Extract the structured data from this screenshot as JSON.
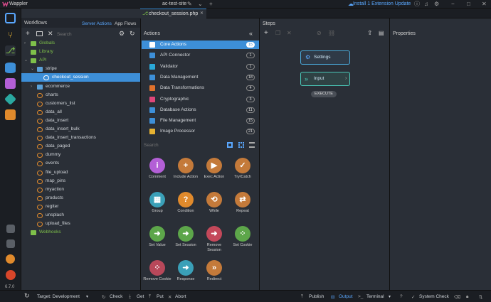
{
  "app": {
    "title": "Wappler",
    "site": "ac-test-site",
    "install_label": "Install 1 Extension Update",
    "version": "6.7.0"
  },
  "colors": {
    "accent": "#3d8fd8",
    "folder": "#5aa0d8",
    "file": "#e08a2c",
    "green": "#7ec04a"
  },
  "workflows": {
    "title": "Workflows",
    "tabs": [
      "Server Actions",
      "App Flows"
    ],
    "search_placeholder": "Search",
    "tree": [
      {
        "label": "Globals",
        "type": "green-folder",
        "level": 0,
        "caret": "right"
      },
      {
        "label": "Library",
        "type": "green-folder",
        "level": 0,
        "caret": ""
      },
      {
        "label": "API",
        "type": "green-folder",
        "level": 0,
        "caret": "down"
      },
      {
        "label": "stripe",
        "type": "folder",
        "level": 1,
        "caret": "down"
      },
      {
        "label": "checkout_session",
        "type": "file",
        "level": 2,
        "caret": "",
        "selected": true
      },
      {
        "label": "ecommerce",
        "type": "folder",
        "level": 1,
        "caret": "right"
      },
      {
        "label": "charts",
        "type": "file",
        "level": 1,
        "caret": ""
      },
      {
        "label": "customers_list",
        "type": "file",
        "level": 1,
        "caret": ""
      },
      {
        "label": "data_all",
        "type": "file",
        "level": 1,
        "caret": ""
      },
      {
        "label": "data_insert",
        "type": "file",
        "level": 1,
        "caret": ""
      },
      {
        "label": "data_insert_bulk",
        "type": "file",
        "level": 1,
        "caret": ""
      },
      {
        "label": "data_insert_transactions",
        "type": "file",
        "level": 1,
        "caret": ""
      },
      {
        "label": "data_paged",
        "type": "file",
        "level": 1,
        "caret": ""
      },
      {
        "label": "dummy",
        "type": "file",
        "level": 1,
        "caret": ""
      },
      {
        "label": "events",
        "type": "file",
        "level": 1,
        "caret": ""
      },
      {
        "label": "file_upload",
        "type": "file",
        "level": 1,
        "caret": ""
      },
      {
        "label": "map_pins",
        "type": "file",
        "level": 1,
        "caret": ""
      },
      {
        "label": "myaction",
        "type": "file",
        "level": 1,
        "caret": ""
      },
      {
        "label": "products",
        "type": "file",
        "level": 1,
        "caret": ""
      },
      {
        "label": "regiter",
        "type": "file",
        "level": 1,
        "caret": ""
      },
      {
        "label": "unsplash",
        "type": "file",
        "level": 1,
        "caret": ""
      },
      {
        "label": "upload_files",
        "type": "file",
        "level": 1,
        "caret": ""
      },
      {
        "label": "Webhooks",
        "type": "green-folder",
        "level": 0,
        "caret": ""
      }
    ]
  },
  "editor_tab": {
    "label": "checkout_session.php",
    "close": "✕"
  },
  "actions": {
    "title": "Actions",
    "search_placeholder": "Search",
    "categories": [
      {
        "label": "Core Actions",
        "count": "15",
        "color": "#3d8fd8",
        "icon": "box-icon",
        "selected": true
      },
      {
        "label": "API Connector",
        "count": "1",
        "color": "#3d8fd8",
        "icon": "api-icon"
      },
      {
        "label": "Validator",
        "count": "1",
        "color": "#2aa8d8",
        "icon": "check-icon"
      },
      {
        "label": "Data Management",
        "count": "18",
        "color": "#3d8fd8",
        "icon": "data-icon"
      },
      {
        "label": "Data Transformations",
        "count": "4",
        "color": "#e0722c",
        "icon": "transform-icon"
      },
      {
        "label": "Cryptographic",
        "count": "3",
        "color": "#e0467a",
        "icon": "key-icon"
      },
      {
        "label": "Database Actions",
        "count": "11",
        "color": "#3d8fd8",
        "icon": "database-icon"
      },
      {
        "label": "File Management",
        "count": "15",
        "color": "#3d8fd8",
        "icon": "file-icon"
      },
      {
        "label": "Image Processor",
        "count": "21",
        "color": "#e6b232",
        "icon": "image-icon"
      }
    ],
    "tools": [
      {
        "label": "Comment",
        "glyph": "i",
        "color": "#b35fd6",
        "icon": "comment-icon"
      },
      {
        "label": "Include Action",
        "glyph": "+",
        "color": "#c47a3a",
        "icon": "include-icon"
      },
      {
        "label": "Exec Action",
        "glyph": "▶",
        "color": "#c47a3a",
        "icon": "exec-icon"
      },
      {
        "label": "Try/Catch",
        "glyph": "✓",
        "color": "#c47a3a",
        "icon": "trycatch-icon"
      },
      {
        "label": "Group",
        "glyph": "▦",
        "color": "#3aa0b8",
        "icon": "group-icon"
      },
      {
        "label": "Condition",
        "glyph": "?",
        "color": "#e08a2c",
        "icon": "condition-icon"
      },
      {
        "label": "While",
        "glyph": "⟲",
        "color": "#c47a3a",
        "icon": "while-icon"
      },
      {
        "label": "Repeat",
        "glyph": "⇄",
        "color": "#c47a3a",
        "icon": "repeat-icon"
      },
      {
        "label": "Set Value",
        "glyph": "➜",
        "color": "#5da64a",
        "icon": "setvalue-icon"
      },
      {
        "label": "Set Session",
        "glyph": "➜",
        "color": "#5da64a",
        "icon": "setsession-icon"
      },
      {
        "label": "Remove Session",
        "glyph": "➜",
        "color": "#c4485a",
        "icon": "removesession-icon"
      },
      {
        "label": "Set Cookie",
        "glyph": "⁘",
        "color": "#5da64a",
        "icon": "setcookie-icon"
      },
      {
        "label": "Remove Cookie",
        "glyph": "⁘",
        "color": "#b8485a",
        "icon": "removecookie-icon"
      },
      {
        "label": "Response",
        "glyph": "➜",
        "color": "#3aa0b8",
        "icon": "response-icon"
      },
      {
        "label": "Redirect",
        "glyph": "»",
        "color": "#c47a3a",
        "icon": "redirect-icon"
      }
    ]
  },
  "steps": {
    "title": "Steps",
    "items": [
      {
        "label": "Settings"
      },
      {
        "label": "Input"
      }
    ],
    "execute_label": "EXECUTE"
  },
  "properties": {
    "title": "Properties"
  },
  "statusbar": {
    "target": "Target: Development",
    "check": "Check",
    "get": "Get",
    "put": "Put",
    "abort": "Abort",
    "publish": "Publish",
    "output": "Output",
    "terminal": "Terminal",
    "system_check": "System Check"
  }
}
